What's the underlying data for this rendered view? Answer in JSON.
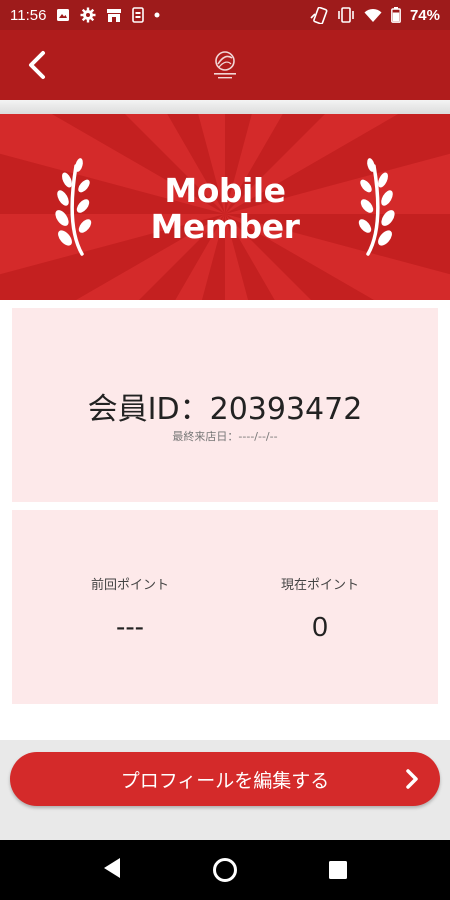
{
  "status_bar": {
    "time": "11:56",
    "battery": "74%",
    "icons": [
      "image-icon",
      "gear-icon",
      "store-icon",
      "sim-icon",
      "dot-icon",
      "phone-link-icon",
      "vibrate-icon",
      "wifi-icon",
      "battery-icon"
    ]
  },
  "header": {
    "back_icon": "chevron-left-icon",
    "logo_icon": "brand-logo-icon"
  },
  "banner": {
    "line1": "Mobile",
    "line2": "Member",
    "colors": {
      "background": "#d42a2a",
      "rays": "#c42020"
    }
  },
  "member": {
    "id_text": "会員ID：20393472",
    "last_visit": "最終来店日：----/--/--"
  },
  "points": {
    "previous_label": "前回ポイント",
    "previous_value": "---",
    "current_label": "現在ポイント",
    "current_value": "0"
  },
  "actions": {
    "edit_profile": "プロフィールを編集する"
  },
  "colors": {
    "header": "#b01c1c",
    "accent": "#d42a2a",
    "card": "#fde9ea"
  }
}
